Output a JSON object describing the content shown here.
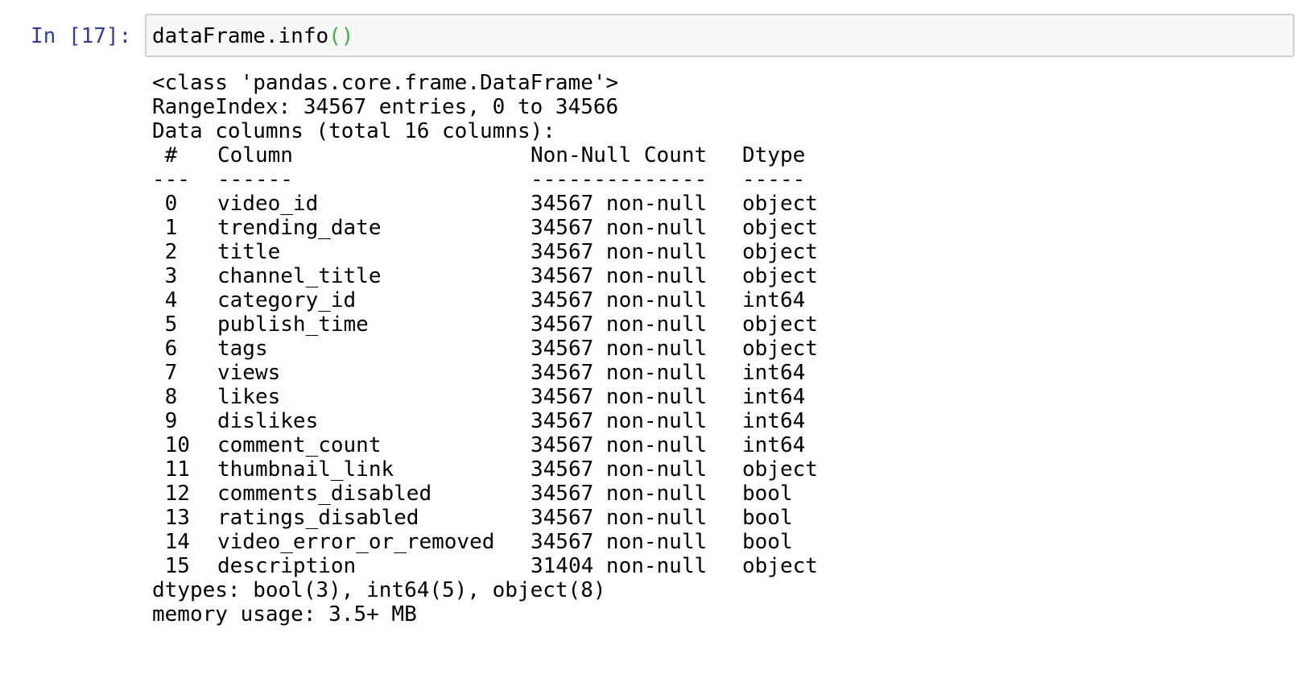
{
  "cell": {
    "prompt": "In [17]:",
    "code": {
      "text": "dataFrame.info",
      "paren": "()"
    }
  },
  "output": {
    "class_line": "<class 'pandas.core.frame.DataFrame'>",
    "range_index": "RangeIndex: 34567 entries, 0 to 34566",
    "data_columns": "Data columns (total 16 columns):",
    "header": {
      "idx": " #",
      "column": "Column",
      "count": "Non-Null Count",
      "dtype": "Dtype"
    },
    "separator": {
      "idx": "---",
      "column": "------",
      "count": "--------------",
      "dtype": "-----"
    },
    "rows": [
      {
        "idx": " 0",
        "column": "video_id",
        "count": "34567 non-null",
        "dtype": "object"
      },
      {
        "idx": " 1",
        "column": "trending_date",
        "count": "34567 non-null",
        "dtype": "object"
      },
      {
        "idx": " 2",
        "column": "title",
        "count": "34567 non-null",
        "dtype": "object"
      },
      {
        "idx": " 3",
        "column": "channel_title",
        "count": "34567 non-null",
        "dtype": "object"
      },
      {
        "idx": " 4",
        "column": "category_id",
        "count": "34567 non-null",
        "dtype": "int64"
      },
      {
        "idx": " 5",
        "column": "publish_time",
        "count": "34567 non-null",
        "dtype": "object"
      },
      {
        "idx": " 6",
        "column": "tags",
        "count": "34567 non-null",
        "dtype": "object"
      },
      {
        "idx": " 7",
        "column": "views",
        "count": "34567 non-null",
        "dtype": "int64"
      },
      {
        "idx": " 8",
        "column": "likes",
        "count": "34567 non-null",
        "dtype": "int64"
      },
      {
        "idx": " 9",
        "column": "dislikes",
        "count": "34567 non-null",
        "dtype": "int64"
      },
      {
        "idx": " 10",
        "column": "comment_count",
        "count": "34567 non-null",
        "dtype": "int64"
      },
      {
        "idx": " 11",
        "column": "thumbnail_link",
        "count": "34567 non-null",
        "dtype": "object"
      },
      {
        "idx": " 12",
        "column": "comments_disabled",
        "count": "34567 non-null",
        "dtype": "bool"
      },
      {
        "idx": " 13",
        "column": "ratings_disabled",
        "count": "34567 non-null",
        "dtype": "bool"
      },
      {
        "idx": " 14",
        "column": "video_error_or_removed",
        "count": "34567 non-null",
        "dtype": "bool"
      },
      {
        "idx": " 15",
        "column": "description",
        "count": "31404 non-null",
        "dtype": "object"
      }
    ],
    "dtypes_line": "dtypes: bool(3), int64(5), object(8)",
    "memory_line": "memory usage: 3.5+ MB"
  },
  "colors": {
    "prompt": "#303f9f",
    "paren": "#3bb13b",
    "input_bg": "#f7f7f7",
    "input_border": "#cfcfcf"
  }
}
